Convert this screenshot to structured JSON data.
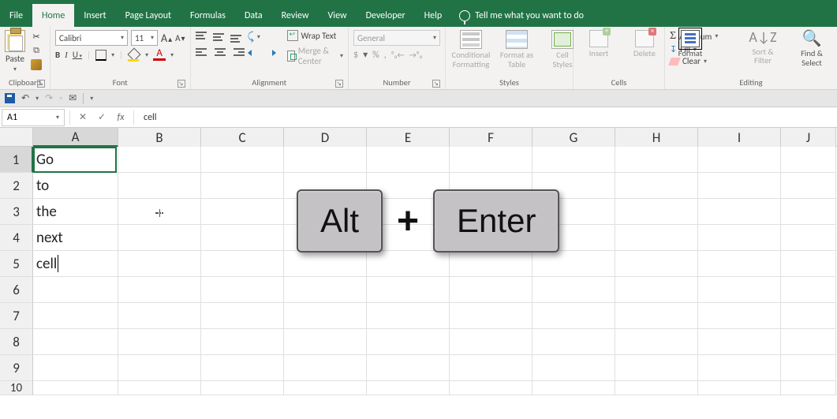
{
  "tabs": {
    "file": "File",
    "home": "Home",
    "insert": "Insert",
    "page_layout": "Page Layout",
    "formulas": "Formulas",
    "data": "Data",
    "review": "Review",
    "view": "View",
    "developer": "Developer",
    "help": "Help",
    "tellme": "Tell me what you want to do"
  },
  "ribbon": {
    "clipboard": {
      "label": "Clipboard",
      "paste": "Paste"
    },
    "font": {
      "label": "Font",
      "name": "Calibri",
      "size": "11",
      "bold": "B",
      "italic": "I",
      "underline": "U",
      "font_color_letter": "A"
    },
    "alignment": {
      "label": "Alignment",
      "wrap": "Wrap Text",
      "merge": "Merge & Center"
    },
    "number": {
      "label": "Number",
      "format": "General",
      "dollar": "$",
      "percent": "%",
      "comma": ",",
      "inc": ".0₀",
      "dec": "₀.0"
    },
    "styles": {
      "label": "Styles",
      "cond": "Conditional\nFormatting",
      "fat": "Format as\nTable",
      "cell": "Cell\nStyles"
    },
    "cells": {
      "label": "Cells",
      "insert": "Insert",
      "delete": "Delete",
      "format": "Format"
    },
    "editing": {
      "label": "Editing",
      "autosum": "AutoSum",
      "fill": "Fill",
      "clear": "Clear",
      "sort": "Sort &\nFilter",
      "find": "Find &\nSelect"
    }
  },
  "fxbar": {
    "namebox": "A1",
    "cancel": "✕",
    "enter": "✓",
    "fx": "fx",
    "formula": "cell"
  },
  "columns": [
    "A",
    "B",
    "C",
    "D",
    "E",
    "F",
    "G",
    "H",
    "I",
    "J"
  ],
  "row_numbers": [
    "1",
    "2",
    "3",
    "4",
    "5",
    "6",
    "7",
    "8",
    "9",
    "10"
  ],
  "cells": {
    "A1": "Go",
    "A2": "to",
    "A3": "the",
    "A4": "next",
    "A5": "cell"
  },
  "overlay": {
    "key1": "Alt",
    "plus": "+",
    "key2": "Enter"
  }
}
